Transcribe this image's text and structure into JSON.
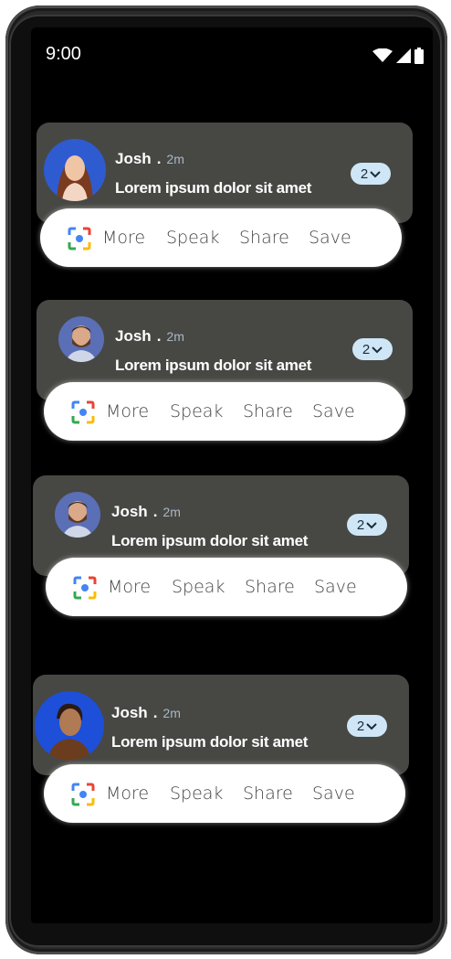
{
  "status_bar": {
    "time": "9:00",
    "icons": [
      "wifi-icon",
      "signal-icon",
      "battery-icon"
    ]
  },
  "notifications": [
    {
      "name": "Josh",
      "separator": ".",
      "time": "2m",
      "message": "Lorem ipsum dolor sit amet",
      "count": "2",
      "avatar": "woman-avatar",
      "actions": [
        "More",
        "Speak",
        "Share",
        "Save"
      ]
    },
    {
      "name": "Josh",
      "separator": ".",
      "time": "2m",
      "message": "Lorem ipsum dolor sit amet",
      "count": "2",
      "avatar": "bearded-man-avatar",
      "actions": [
        "More",
        "Speak",
        "Share",
        "Save"
      ]
    },
    {
      "name": "Josh",
      "separator": ".",
      "time": "2m",
      "message": "Lorem ipsum dolor sit amet",
      "count": "2",
      "avatar": "bearded-man-avatar",
      "actions": [
        "More",
        "Speak",
        "Share",
        "Save"
      ]
    },
    {
      "name": "Josh",
      "separator": ".",
      "time": "2m",
      "message": "Lorem ipsum dolor sit amet",
      "count": "2",
      "avatar": "man-avatar",
      "actions": [
        "More",
        "Speak",
        "Share",
        "Save"
      ]
    }
  ],
  "colors": {
    "card": "#474844",
    "pill": "#cfe6f6",
    "screen": "#000000",
    "action_bar": "#ffffff"
  }
}
